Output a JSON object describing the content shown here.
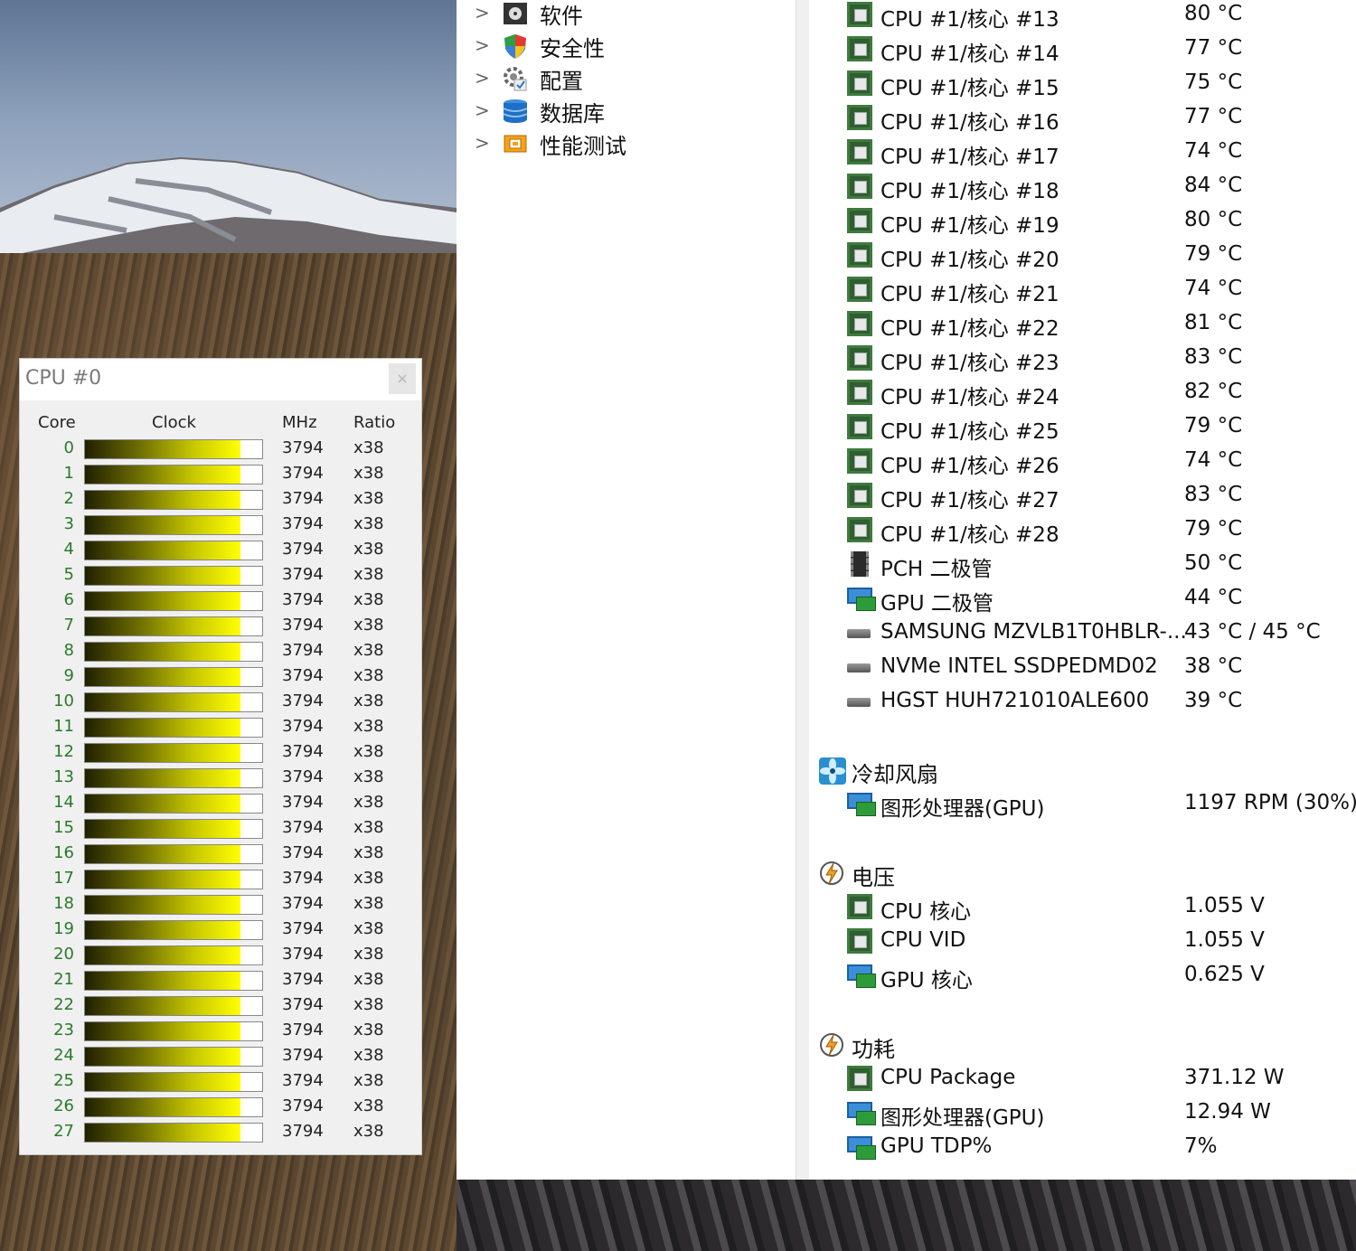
{
  "cpu_window": {
    "title": "CPU #0",
    "close": "×",
    "headers": {
      "core": "Core",
      "clock": "Clock",
      "mhz": "MHz",
      "ratio": "Ratio"
    },
    "clock_bar_fraction": 0.88,
    "cores": [
      {
        "core": "0",
        "mhz": "3794",
        "ratio": "x38"
      },
      {
        "core": "1",
        "mhz": "3794",
        "ratio": "x38"
      },
      {
        "core": "2",
        "mhz": "3794",
        "ratio": "x38"
      },
      {
        "core": "3",
        "mhz": "3794",
        "ratio": "x38"
      },
      {
        "core": "4",
        "mhz": "3794",
        "ratio": "x38"
      },
      {
        "core": "5",
        "mhz": "3794",
        "ratio": "x38"
      },
      {
        "core": "6",
        "mhz": "3794",
        "ratio": "x38"
      },
      {
        "core": "7",
        "mhz": "3794",
        "ratio": "x38"
      },
      {
        "core": "8",
        "mhz": "3794",
        "ratio": "x38"
      },
      {
        "core": "9",
        "mhz": "3794",
        "ratio": "x38"
      },
      {
        "core": "10",
        "mhz": "3794",
        "ratio": "x38"
      },
      {
        "core": "11",
        "mhz": "3794",
        "ratio": "x38"
      },
      {
        "core": "12",
        "mhz": "3794",
        "ratio": "x38"
      },
      {
        "core": "13",
        "mhz": "3794",
        "ratio": "x38"
      },
      {
        "core": "14",
        "mhz": "3794",
        "ratio": "x38"
      },
      {
        "core": "15",
        "mhz": "3794",
        "ratio": "x38"
      },
      {
        "core": "16",
        "mhz": "3794",
        "ratio": "x38"
      },
      {
        "core": "17",
        "mhz": "3794",
        "ratio": "x38"
      },
      {
        "core": "18",
        "mhz": "3794",
        "ratio": "x38"
      },
      {
        "core": "19",
        "mhz": "3794",
        "ratio": "x38"
      },
      {
        "core": "20",
        "mhz": "3794",
        "ratio": "x38"
      },
      {
        "core": "21",
        "mhz": "3794",
        "ratio": "x38"
      },
      {
        "core": "22",
        "mhz": "3794",
        "ratio": "x38"
      },
      {
        "core": "23",
        "mhz": "3794",
        "ratio": "x38"
      },
      {
        "core": "24",
        "mhz": "3794",
        "ratio": "x38"
      },
      {
        "core": "25",
        "mhz": "3794",
        "ratio": "x38"
      },
      {
        "core": "26",
        "mhz": "3794",
        "ratio": "x38"
      },
      {
        "core": "27",
        "mhz": "3794",
        "ratio": "x38"
      }
    ]
  },
  "tree": [
    {
      "label": "软件",
      "icon": "software-icon"
    },
    {
      "label": "安全性",
      "icon": "shield-icon"
    },
    {
      "label": "配置",
      "icon": "gear-icon"
    },
    {
      "label": "数据库",
      "icon": "database-icon"
    },
    {
      "label": "性能测试",
      "icon": "benchmark-icon"
    }
  ],
  "temperatures": [
    {
      "label": "CPU #1/核心 #13",
      "value": "80 °C",
      "icon": "cpu-chip-icon"
    },
    {
      "label": "CPU #1/核心 #14",
      "value": "77 °C",
      "icon": "cpu-chip-icon"
    },
    {
      "label": "CPU #1/核心 #15",
      "value": "75 °C",
      "icon": "cpu-chip-icon"
    },
    {
      "label": "CPU #1/核心 #16",
      "value": "77 °C",
      "icon": "cpu-chip-icon"
    },
    {
      "label": "CPU #1/核心 #17",
      "value": "74 °C",
      "icon": "cpu-chip-icon"
    },
    {
      "label": "CPU #1/核心 #18",
      "value": "84 °C",
      "icon": "cpu-chip-icon"
    },
    {
      "label": "CPU #1/核心 #19",
      "value": "80 °C",
      "icon": "cpu-chip-icon"
    },
    {
      "label": "CPU #1/核心 #20",
      "value": "79 °C",
      "icon": "cpu-chip-icon"
    },
    {
      "label": "CPU #1/核心 #21",
      "value": "74 °C",
      "icon": "cpu-chip-icon"
    },
    {
      "label": "CPU #1/核心 #22",
      "value": "81 °C",
      "icon": "cpu-chip-icon"
    },
    {
      "label": "CPU #1/核心 #23",
      "value": "83 °C",
      "icon": "cpu-chip-icon"
    },
    {
      "label": "CPU #1/核心 #24",
      "value": "82 °C",
      "icon": "cpu-chip-icon"
    },
    {
      "label": "CPU #1/核心 #25",
      "value": "79 °C",
      "icon": "cpu-chip-icon"
    },
    {
      "label": "CPU #1/核心 #26",
      "value": "74 °C",
      "icon": "cpu-chip-icon"
    },
    {
      "label": "CPU #1/核心 #27",
      "value": "83 °C",
      "icon": "cpu-chip-icon"
    },
    {
      "label": "CPU #1/核心 #28",
      "value": "79 °C",
      "icon": "cpu-chip-icon"
    },
    {
      "label": "PCH 二极管",
      "value": "50 °C",
      "icon": "pch-chip-icon"
    },
    {
      "label": "GPU 二极管",
      "value": "44 °C",
      "icon": "gpu-monitor-icon"
    },
    {
      "label": "SAMSUNG MZVLB1T0HBLR-...",
      "value": "43 °C / 45 °C",
      "icon": "disk-icon"
    },
    {
      "label": "NVMe INTEL SSDPEDMD02",
      "value": "38 °C",
      "icon": "disk-icon"
    },
    {
      "label": "HGST HUH721010ALE600",
      "value": "39 °C",
      "icon": "disk-icon"
    }
  ],
  "groups": {
    "fans": {
      "title": "冷却风扇",
      "icon": "fan-icon",
      "items": [
        {
          "label": "图形处理器(GPU)",
          "value": "1197 RPM  (30%)",
          "icon": "gpu-monitor-icon"
        }
      ]
    },
    "voltage": {
      "title": "电压",
      "icon": "lightning-icon",
      "items": [
        {
          "label": "CPU 核心",
          "value": "1.055 V",
          "icon": "cpu-chip-icon"
        },
        {
          "label": "CPU VID",
          "value": "1.055 V",
          "icon": "cpu-chip-icon"
        },
        {
          "label": "GPU 核心",
          "value": "0.625 V",
          "icon": "gpu-monitor-icon"
        }
      ]
    },
    "power": {
      "title": "功耗",
      "icon": "lightning-icon",
      "items": [
        {
          "label": "CPU Package",
          "value": "371.12 W",
          "icon": "cpu-chip-icon"
        },
        {
          "label": "图形处理器(GPU)",
          "value": "12.94 W",
          "icon": "gpu-monitor-icon"
        },
        {
          "label": "GPU TDP%",
          "value": "7%",
          "icon": "gpu-monitor-icon"
        }
      ]
    }
  }
}
